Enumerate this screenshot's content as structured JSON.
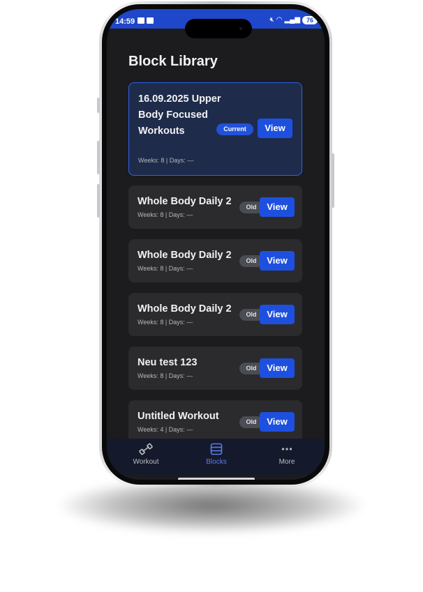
{
  "status_bar": {
    "time": "14:59",
    "battery": "76",
    "accent_color": "#1f47c9"
  },
  "header": {
    "title": "Block Library"
  },
  "blocks": [
    {
      "title": "16.09.2025 Upper Body Focused Workouts",
      "meta": "Weeks: 8 | Days: —",
      "badge": "Current",
      "action": "View"
    },
    {
      "title": "Whole Body Daily 2",
      "meta": "Weeks: 8 | Days: —",
      "badge": "Old",
      "action": "View"
    },
    {
      "title": "Whole Body Daily 2",
      "meta": "Weeks: 8 | Days: —",
      "badge": "Old",
      "action": "View"
    },
    {
      "title": "Whole Body Daily 2",
      "meta": "Weeks: 8 | Days: —",
      "badge": "Old",
      "action": "View"
    },
    {
      "title": "Neu test 123",
      "meta": "Weeks: 8 | Days: —",
      "badge": "Old",
      "action": "View"
    },
    {
      "title": "Untitled Workout",
      "meta": "Weeks: 4 | Days: —",
      "badge": "Old",
      "action": "View"
    }
  ],
  "tab_bar": {
    "tabs": [
      {
        "label": "Workout",
        "icon": "dumbbell-icon",
        "active": false
      },
      {
        "label": "Blocks",
        "icon": "blocks-list-icon",
        "active": true
      },
      {
        "label": "More",
        "icon": "more-dots-icon",
        "active": false
      }
    ],
    "active_color": "#5a7cf0"
  }
}
